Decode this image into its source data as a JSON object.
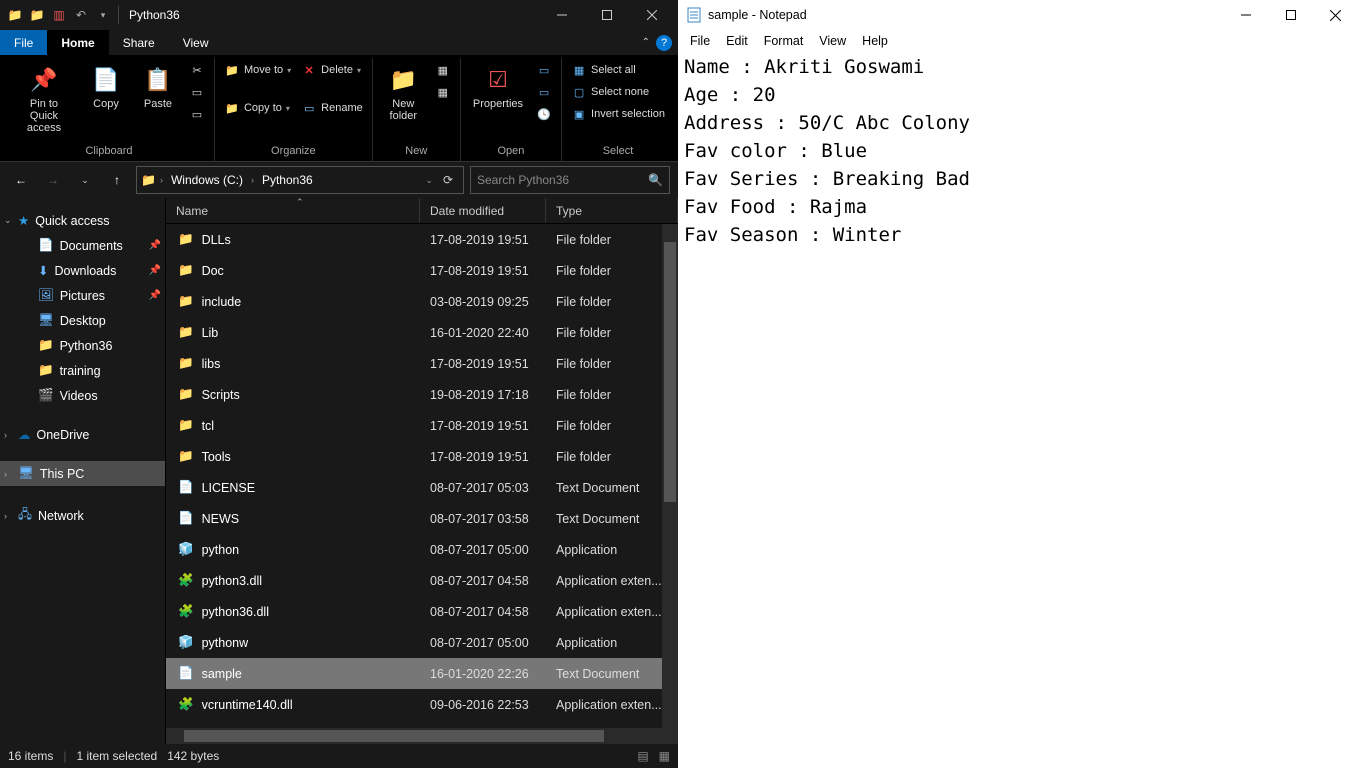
{
  "explorer": {
    "title": "Python36",
    "tabs": {
      "file": "File",
      "home": "Home",
      "share": "Share",
      "view": "View"
    },
    "ribbon": {
      "clipboard": {
        "label": "Clipboard",
        "pin": "Pin to Quick access",
        "copy": "Copy",
        "paste": "Paste"
      },
      "organize": {
        "label": "Organize",
        "moveto": "Move to",
        "copyto": "Copy to",
        "delete": "Delete",
        "rename": "Rename"
      },
      "new": {
        "label": "New",
        "newfolder": "New folder"
      },
      "open": {
        "label": "Open",
        "properties": "Properties"
      },
      "select": {
        "label": "Select",
        "selectall": "Select all",
        "selectnone": "Select none",
        "invert": "Invert selection"
      }
    },
    "breadcrumbs": [
      "Windows (C:)",
      "Python36"
    ],
    "search_placeholder": "Search Python36",
    "sidebar": {
      "quick_access": "Quick access",
      "items": [
        "Documents",
        "Downloads",
        "Pictures",
        "Desktop",
        "Python36",
        "training",
        "Videos"
      ],
      "onedrive": "OneDrive",
      "thispc": "This PC",
      "network": "Network"
    },
    "columns": {
      "name": "Name",
      "date": "Date modified",
      "type": "Type"
    },
    "files": [
      {
        "name": "DLLs",
        "date": "17-08-2019 19:51",
        "type": "File folder",
        "kind": "folder"
      },
      {
        "name": "Doc",
        "date": "17-08-2019 19:51",
        "type": "File folder",
        "kind": "folder"
      },
      {
        "name": "include",
        "date": "03-08-2019 09:25",
        "type": "File folder",
        "kind": "folder"
      },
      {
        "name": "Lib",
        "date": "16-01-2020 22:40",
        "type": "File folder",
        "kind": "folder"
      },
      {
        "name": "libs",
        "date": "17-08-2019 19:51",
        "type": "File folder",
        "kind": "folder"
      },
      {
        "name": "Scripts",
        "date": "19-08-2019 17:18",
        "type": "File folder",
        "kind": "folder"
      },
      {
        "name": "tcl",
        "date": "17-08-2019 19:51",
        "type": "File folder",
        "kind": "folder"
      },
      {
        "name": "Tools",
        "date": "17-08-2019 19:51",
        "type": "File folder",
        "kind": "folder"
      },
      {
        "name": "LICENSE",
        "date": "08-07-2017 05:03",
        "type": "Text Document",
        "kind": "text"
      },
      {
        "name": "NEWS",
        "date": "08-07-2017 03:58",
        "type": "Text Document",
        "kind": "text"
      },
      {
        "name": "python",
        "date": "08-07-2017 05:00",
        "type": "Application",
        "kind": "app"
      },
      {
        "name": "python3.dll",
        "date": "08-07-2017 04:58",
        "type": "Application exten...",
        "kind": "dll"
      },
      {
        "name": "python36.dll",
        "date": "08-07-2017 04:58",
        "type": "Application exten...",
        "kind": "dll"
      },
      {
        "name": "pythonw",
        "date": "08-07-2017 05:00",
        "type": "Application",
        "kind": "app"
      },
      {
        "name": "sample",
        "date": "16-01-2020 22:26",
        "type": "Text Document",
        "kind": "text",
        "selected": true
      },
      {
        "name": "vcruntime140.dll",
        "date": "09-06-2016 22:53",
        "type": "Application exten...",
        "kind": "dll"
      }
    ],
    "status": {
      "items": "16 items",
      "selected": "1 item selected",
      "size": "142 bytes"
    }
  },
  "notepad": {
    "title": "sample - Notepad",
    "menu": [
      "File",
      "Edit",
      "Format",
      "View",
      "Help"
    ],
    "content": "Name : Akriti Goswami\nAge : 20\nAddress : 50/C Abc Colony\nFav color : Blue\nFav Series : Breaking Bad\nFav Food : Rajma\nFav Season : Winter"
  }
}
